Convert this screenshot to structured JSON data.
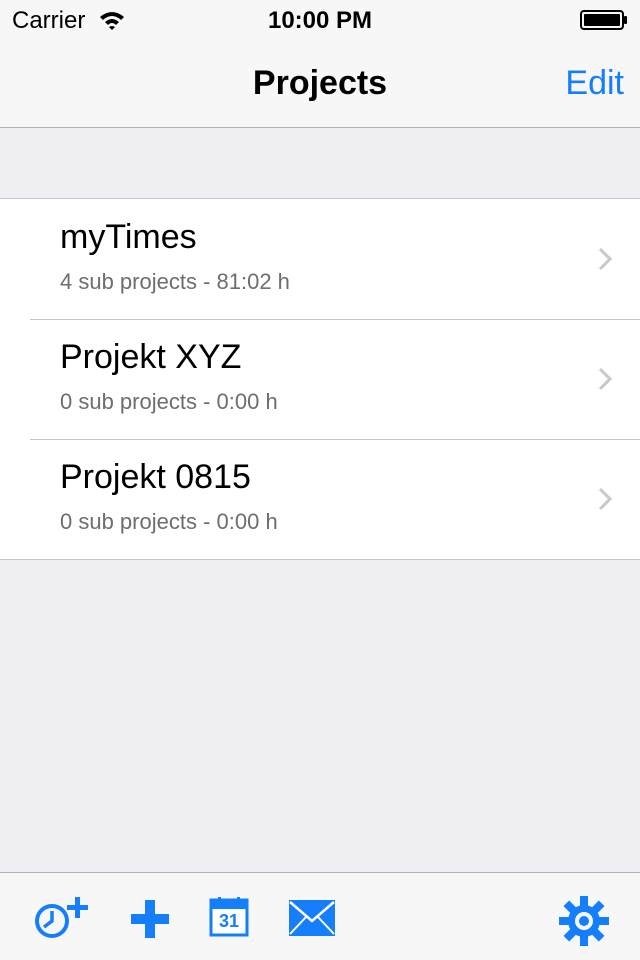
{
  "status_bar": {
    "carrier": "Carrier",
    "time": "10:00 PM",
    "wifi_icon": "wifi-icon",
    "battery_icon": "battery-icon"
  },
  "nav": {
    "title": "Projects",
    "edit_label": "Edit"
  },
  "projects": [
    {
      "name": "myTimes",
      "details": "4 sub projects - 81:02 h"
    },
    {
      "name": "Projekt XYZ",
      "details": "0 sub projects - 0:00 h"
    },
    {
      "name": "Projekt 0815",
      "details": "0 sub projects - 0:00 h"
    }
  ],
  "toolbar": {
    "icons": [
      "add-time-clock-icon",
      "plus-icon",
      "calendar-icon",
      "mail-icon",
      "gear-icon"
    ],
    "calendar_day": "31"
  },
  "colors": {
    "accent": "#157efb",
    "background": "#efeff4",
    "bar": "#f7f7f7",
    "separator": "#c8c7cc",
    "secondary_text": "#6d6d72"
  }
}
